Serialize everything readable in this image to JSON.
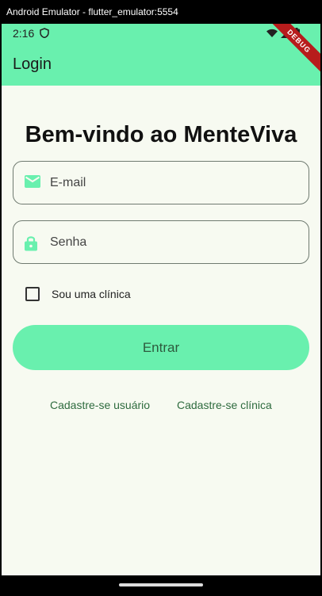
{
  "window": {
    "title": "Android Emulator - flutter_emulator:5554"
  },
  "status_bar": {
    "time": "2:16"
  },
  "app_bar": {
    "title": "Login"
  },
  "debug_banner": "DEBUG",
  "main": {
    "heading": "Bem-vindo ao MenteViva",
    "email": {
      "placeholder": "E-mail",
      "value": ""
    },
    "password": {
      "placeholder": "Senha",
      "value": ""
    },
    "clinic_checkbox": {
      "label": "Sou uma clínica",
      "checked": false
    },
    "login_button": "Entrar",
    "links": {
      "register_user": "Cadastre-se usuário",
      "register_clinic": "Cadastre-se clínica"
    }
  },
  "colors": {
    "accent": "#69f0ae",
    "background": "#f7faf1",
    "link": "#2e6b3e"
  },
  "icons": [
    "shield-icon",
    "wifi-icon",
    "signal-icon",
    "battery-icon",
    "email-icon",
    "lock-icon"
  ]
}
